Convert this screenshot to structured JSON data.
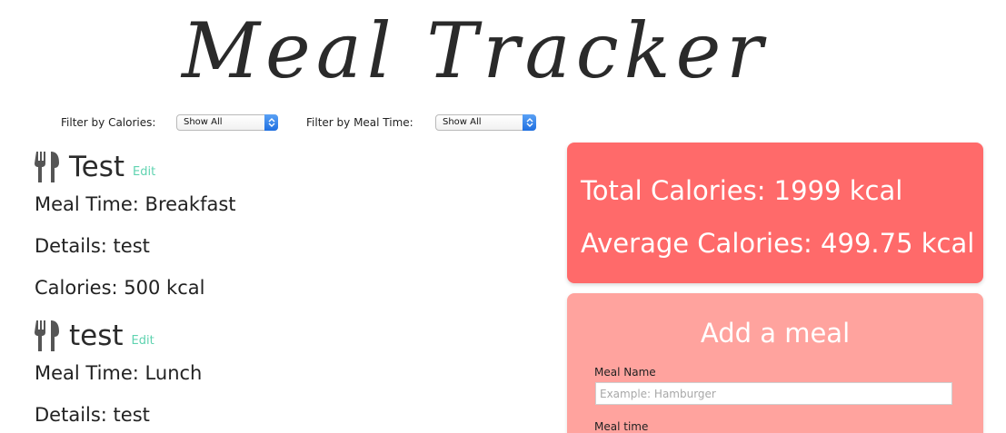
{
  "header": {
    "title": "Meal Tracker"
  },
  "filters": {
    "calories": {
      "label": "Filter by Calories:",
      "selected": "Show All"
    },
    "meal_time": {
      "label": "Filter by Meal Time:",
      "selected": "Show All"
    }
  },
  "meals": [
    {
      "name": "Test",
      "edit_label": "Edit",
      "meal_time": "Meal Time: Breakfast",
      "details": "Details: test",
      "calories": "Calories: 500 kcal"
    },
    {
      "name": "test",
      "edit_label": "Edit",
      "meal_time": "Meal Time: Lunch",
      "details": "Details: test"
    }
  ],
  "stats": {
    "total": "Total Calories: 1999 kcal",
    "average": "Average Calories: 499.75 kcal"
  },
  "add_meal": {
    "title": "Add a meal",
    "name_label": "Meal Name",
    "name_placeholder": "Example: Hamburger",
    "time_label": "Meal time"
  },
  "colors": {
    "stats_bg": "#ff6a6a",
    "add_bg": "#ffa39e",
    "edit_link": "#5fd3b0",
    "select_accent": "#1f6fe0"
  },
  "icons": {
    "meal_icon": "fork-knife-icon",
    "select_icon": "chevron-updown-icon"
  }
}
